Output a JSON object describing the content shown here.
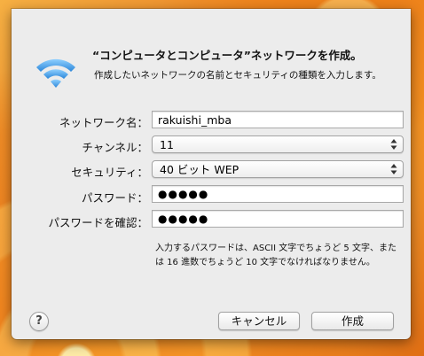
{
  "dialog": {
    "title": "“コンピュータとコンピュータ”ネットワークを作成。",
    "description": "作成したいネットワークの名前とセキュリティの種類を入力します。",
    "icon": "wifi-icon"
  },
  "form": {
    "network_name": {
      "label": "ネットワーク名：",
      "value": "rakuishi_mba"
    },
    "channel": {
      "label": "チャンネル：",
      "value": "11"
    },
    "security": {
      "label": "セキュリティ：",
      "value": "40 ビット WEP"
    },
    "password": {
      "label": "パスワード：",
      "value": "●●●●●"
    },
    "confirm_password": {
      "label": "パスワードを確認：",
      "value": "●●●●●"
    },
    "hint": "入力するパスワードは、ASCII 文字でちょうど 5 文字、または 16 進数でちょうど 10 文字でなければなりません。"
  },
  "buttons": {
    "help": "?",
    "cancel": "キャンセル",
    "create": "作成"
  },
  "colors": {
    "wifi_blue": "#3a9be6",
    "sheet_bg": "#ececec"
  }
}
